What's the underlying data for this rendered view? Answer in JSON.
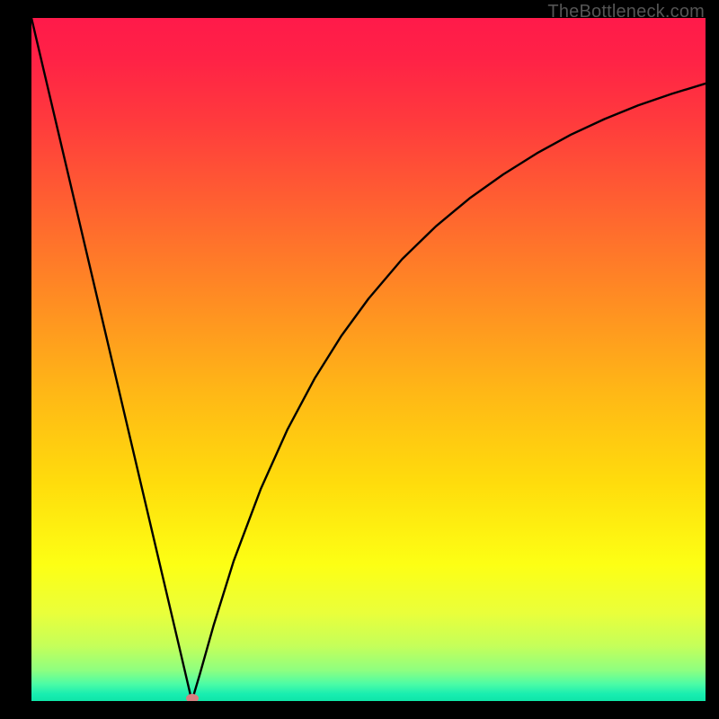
{
  "watermark": "TheBottleneck.com",
  "gradient": {
    "stops": [
      {
        "pos": 0.0,
        "color": "#ff1a4a"
      },
      {
        "pos": 0.06,
        "color": "#ff2246"
      },
      {
        "pos": 0.15,
        "color": "#ff3a3d"
      },
      {
        "pos": 0.28,
        "color": "#ff6330"
      },
      {
        "pos": 0.42,
        "color": "#ff8f22"
      },
      {
        "pos": 0.55,
        "color": "#ffb816"
      },
      {
        "pos": 0.68,
        "color": "#ffdc0c"
      },
      {
        "pos": 0.8,
        "color": "#fdff14"
      },
      {
        "pos": 0.87,
        "color": "#eaff3a"
      },
      {
        "pos": 0.92,
        "color": "#c4ff5a"
      },
      {
        "pos": 0.955,
        "color": "#8eff80"
      },
      {
        "pos": 0.975,
        "color": "#4cfca6"
      },
      {
        "pos": 0.99,
        "color": "#18edb0"
      },
      {
        "pos": 1.0,
        "color": "#0fe6a9"
      }
    ]
  },
  "chart_data": {
    "type": "line",
    "title": "",
    "xlabel": "",
    "ylabel": "",
    "xlim": [
      0,
      100
    ],
    "ylim": [
      0,
      100
    ],
    "series": [
      {
        "name": "bottleneck-curve",
        "x": [
          0,
          2,
          4,
          6,
          8,
          10,
          12,
          14,
          16,
          18,
          20,
          22,
          23.8,
          25,
          27,
          30,
          34,
          38,
          42,
          46,
          50,
          55,
          60,
          65,
          70,
          75,
          80,
          85,
          90,
          95,
          100
        ],
        "y": [
          100,
          91.6,
          83.2,
          74.8,
          66.4,
          58.0,
          49.6,
          41.2,
          32.8,
          24.4,
          16.0,
          7.6,
          0.0,
          4.0,
          11.0,
          20.5,
          31.0,
          39.8,
          47.2,
          53.5,
          58.9,
          64.7,
          69.5,
          73.6,
          77.1,
          80.2,
          82.9,
          85.2,
          87.2,
          88.9,
          90.4
        ]
      }
    ],
    "markers": [
      {
        "name": "optimal-point",
        "x": 23.8,
        "y": 0.4,
        "color": "#d67f81"
      }
    ]
  }
}
